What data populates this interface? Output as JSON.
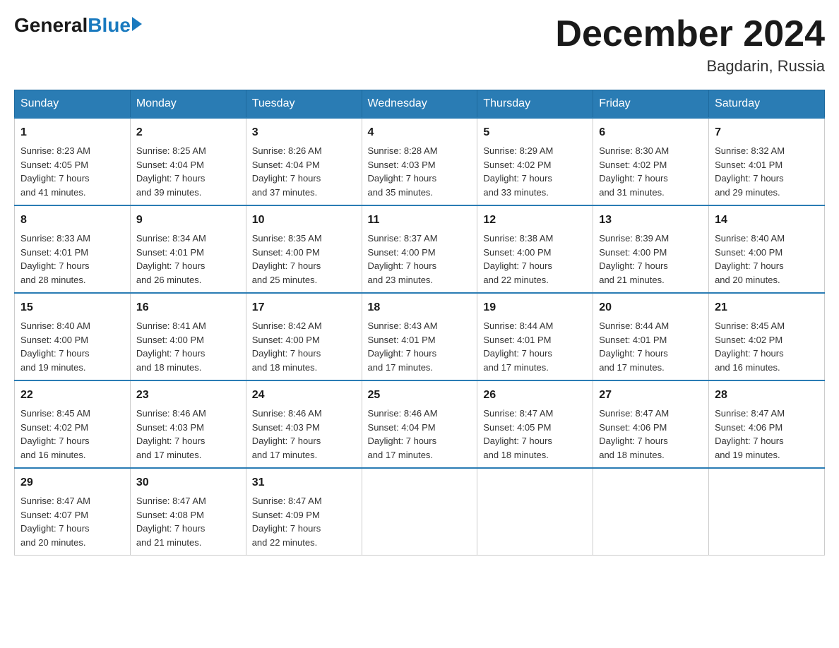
{
  "logo": {
    "general": "General",
    "blue": "Blue"
  },
  "title": "December 2024",
  "location": "Bagdarin, Russia",
  "days_of_week": [
    "Sunday",
    "Monday",
    "Tuesday",
    "Wednesday",
    "Thursday",
    "Friday",
    "Saturday"
  ],
  "weeks": [
    [
      {
        "day": "1",
        "sunrise": "8:23 AM",
        "sunset": "4:05 PM",
        "daylight": "7 hours and 41 minutes."
      },
      {
        "day": "2",
        "sunrise": "8:25 AM",
        "sunset": "4:04 PM",
        "daylight": "7 hours and 39 minutes."
      },
      {
        "day": "3",
        "sunrise": "8:26 AM",
        "sunset": "4:04 PM",
        "daylight": "7 hours and 37 minutes."
      },
      {
        "day": "4",
        "sunrise": "8:28 AM",
        "sunset": "4:03 PM",
        "daylight": "7 hours and 35 minutes."
      },
      {
        "day": "5",
        "sunrise": "8:29 AM",
        "sunset": "4:02 PM",
        "daylight": "7 hours and 33 minutes."
      },
      {
        "day": "6",
        "sunrise": "8:30 AM",
        "sunset": "4:02 PM",
        "daylight": "7 hours and 31 minutes."
      },
      {
        "day": "7",
        "sunrise": "8:32 AM",
        "sunset": "4:01 PM",
        "daylight": "7 hours and 29 minutes."
      }
    ],
    [
      {
        "day": "8",
        "sunrise": "8:33 AM",
        "sunset": "4:01 PM",
        "daylight": "7 hours and 28 minutes."
      },
      {
        "day": "9",
        "sunrise": "8:34 AM",
        "sunset": "4:01 PM",
        "daylight": "7 hours and 26 minutes."
      },
      {
        "day": "10",
        "sunrise": "8:35 AM",
        "sunset": "4:00 PM",
        "daylight": "7 hours and 25 minutes."
      },
      {
        "day": "11",
        "sunrise": "8:37 AM",
        "sunset": "4:00 PM",
        "daylight": "7 hours and 23 minutes."
      },
      {
        "day": "12",
        "sunrise": "8:38 AM",
        "sunset": "4:00 PM",
        "daylight": "7 hours and 22 minutes."
      },
      {
        "day": "13",
        "sunrise": "8:39 AM",
        "sunset": "4:00 PM",
        "daylight": "7 hours and 21 minutes."
      },
      {
        "day": "14",
        "sunrise": "8:40 AM",
        "sunset": "4:00 PM",
        "daylight": "7 hours and 20 minutes."
      }
    ],
    [
      {
        "day": "15",
        "sunrise": "8:40 AM",
        "sunset": "4:00 PM",
        "daylight": "7 hours and 19 minutes."
      },
      {
        "day": "16",
        "sunrise": "8:41 AM",
        "sunset": "4:00 PM",
        "daylight": "7 hours and 18 minutes."
      },
      {
        "day": "17",
        "sunrise": "8:42 AM",
        "sunset": "4:00 PM",
        "daylight": "7 hours and 18 minutes."
      },
      {
        "day": "18",
        "sunrise": "8:43 AM",
        "sunset": "4:01 PM",
        "daylight": "7 hours and 17 minutes."
      },
      {
        "day": "19",
        "sunrise": "8:44 AM",
        "sunset": "4:01 PM",
        "daylight": "7 hours and 17 minutes."
      },
      {
        "day": "20",
        "sunrise": "8:44 AM",
        "sunset": "4:01 PM",
        "daylight": "7 hours and 17 minutes."
      },
      {
        "day": "21",
        "sunrise": "8:45 AM",
        "sunset": "4:02 PM",
        "daylight": "7 hours and 16 minutes."
      }
    ],
    [
      {
        "day": "22",
        "sunrise": "8:45 AM",
        "sunset": "4:02 PM",
        "daylight": "7 hours and 16 minutes."
      },
      {
        "day": "23",
        "sunrise": "8:46 AM",
        "sunset": "4:03 PM",
        "daylight": "7 hours and 17 minutes."
      },
      {
        "day": "24",
        "sunrise": "8:46 AM",
        "sunset": "4:03 PM",
        "daylight": "7 hours and 17 minutes."
      },
      {
        "day": "25",
        "sunrise": "8:46 AM",
        "sunset": "4:04 PM",
        "daylight": "7 hours and 17 minutes."
      },
      {
        "day": "26",
        "sunrise": "8:47 AM",
        "sunset": "4:05 PM",
        "daylight": "7 hours and 18 minutes."
      },
      {
        "day": "27",
        "sunrise": "8:47 AM",
        "sunset": "4:06 PM",
        "daylight": "7 hours and 18 minutes."
      },
      {
        "day": "28",
        "sunrise": "8:47 AM",
        "sunset": "4:06 PM",
        "daylight": "7 hours and 19 minutes."
      }
    ],
    [
      {
        "day": "29",
        "sunrise": "8:47 AM",
        "sunset": "4:07 PM",
        "daylight": "7 hours and 20 minutes."
      },
      {
        "day": "30",
        "sunrise": "8:47 AM",
        "sunset": "4:08 PM",
        "daylight": "7 hours and 21 minutes."
      },
      {
        "day": "31",
        "sunrise": "8:47 AM",
        "sunset": "4:09 PM",
        "daylight": "7 hours and 22 minutes."
      },
      null,
      null,
      null,
      null
    ]
  ],
  "labels": {
    "sunrise": "Sunrise:",
    "sunset": "Sunset:",
    "daylight": "Daylight:"
  }
}
